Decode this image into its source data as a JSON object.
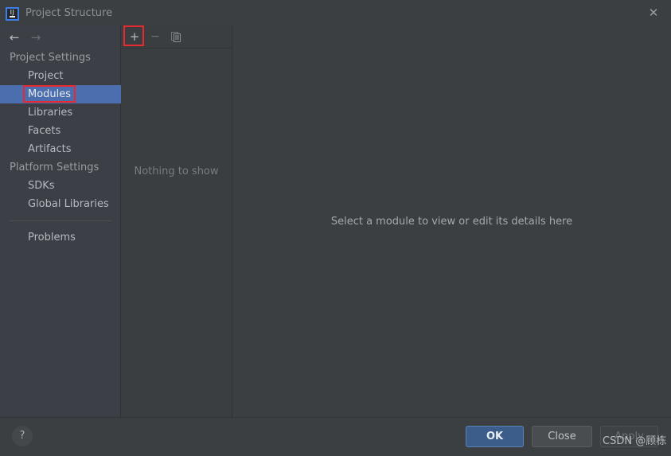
{
  "window": {
    "title": "Project Structure",
    "logo_label": "IJ",
    "close_icon": "close-icon"
  },
  "navigation": {
    "back_icon": "arrow-left-icon",
    "forward_icon": "arrow-right-icon"
  },
  "sidebar": {
    "groups": [
      {
        "label": "Project Settings",
        "items": [
          {
            "label": "Project",
            "selected": false
          },
          {
            "label": "Modules",
            "selected": true
          },
          {
            "label": "Libraries",
            "selected": false
          },
          {
            "label": "Facets",
            "selected": false
          },
          {
            "label": "Artifacts",
            "selected": false
          }
        ]
      },
      {
        "label": "Platform Settings",
        "items": [
          {
            "label": "SDKs",
            "selected": false
          },
          {
            "label": "Global Libraries",
            "selected": false
          }
        ]
      }
    ],
    "extra_items": [
      {
        "label": "Problems"
      }
    ]
  },
  "middle_panel": {
    "toolbar": {
      "add_label": "+",
      "remove_label": "−",
      "copy_icon": "copy-icon"
    },
    "empty_text": "Nothing to show"
  },
  "right_panel": {
    "empty_text": "Select a module to view or edit its details here"
  },
  "footer": {
    "help_label": "?",
    "ok_label": "OK",
    "close_label": "Close",
    "apply_label": "Apply"
  },
  "watermark": {
    "text": "CSDN @顾栋"
  },
  "colors": {
    "selection_blue": "#4b6eaf",
    "annotation_red": "#e8292f",
    "ok_button_blue": "#3c5d8a",
    "dialog_background": "#3c3f41"
  }
}
